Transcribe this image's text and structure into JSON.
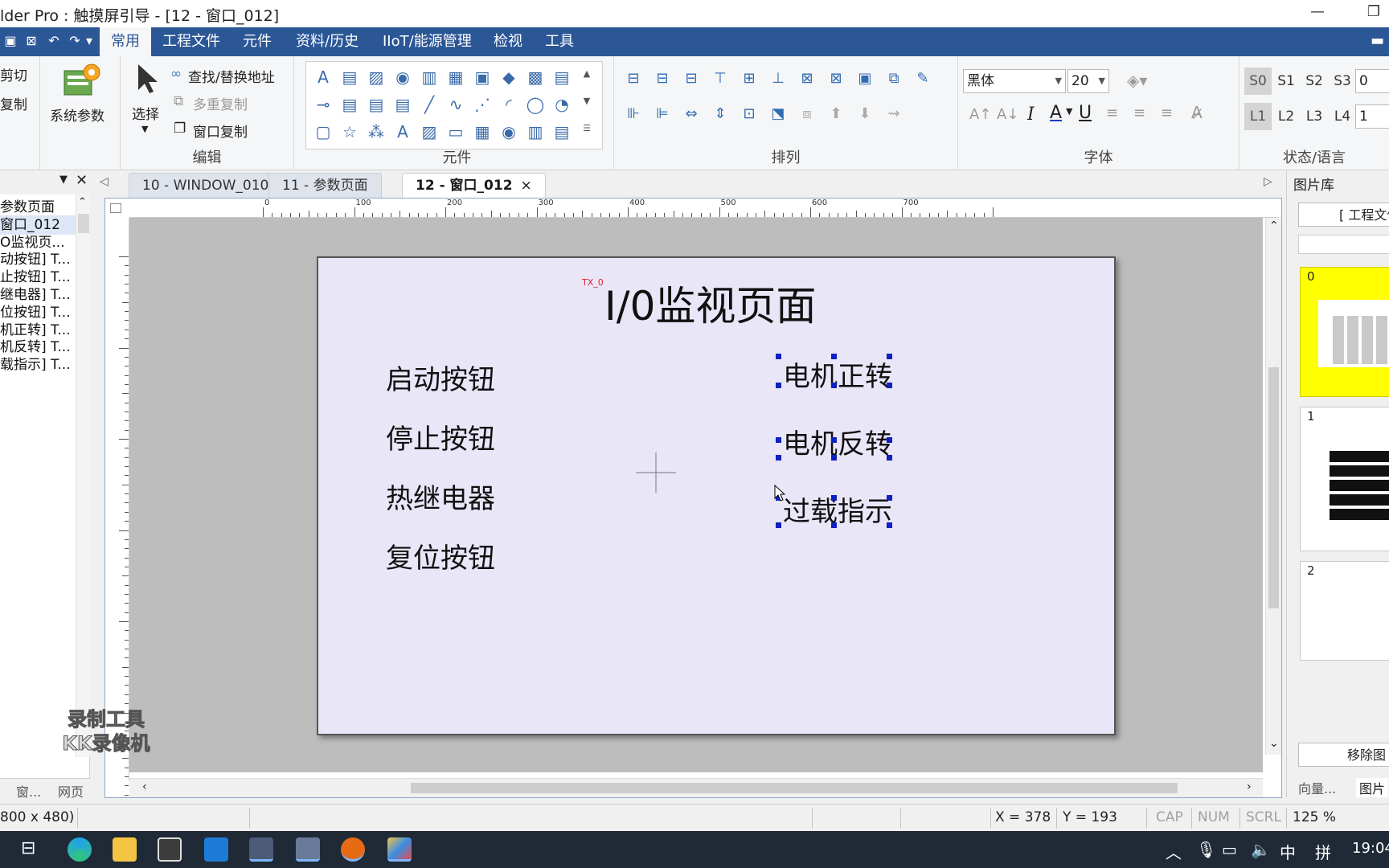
{
  "window": {
    "title": "lder Pro : 触摸屏引导 - [12 - 窗口_012]",
    "minimize_glyph": "—",
    "restore_glyph": "❐"
  },
  "menu": {
    "tabs": [
      "常用",
      "工程文件",
      "元件",
      "资料/历史",
      "IIoT/能源管理",
      "检视",
      "工具"
    ],
    "active_tab": "常用"
  },
  "ribbon": {
    "clipboard": {
      "cut": "剪切",
      "copy": "复制"
    },
    "system_params": "系统参数",
    "select": "选择",
    "edit": {
      "find_replace": "查找/替换地址",
      "multi_copy": "多重复制",
      "window_copy": "窗口复制",
      "group_label": "编辑"
    },
    "elements_label": "元件",
    "arrange_label": "排列",
    "font": {
      "name": "黑体",
      "size": "20",
      "group_label": "字体"
    },
    "state": {
      "s_buttons": [
        "S0",
        "S1",
        "S2",
        "S3"
      ],
      "s_value": "0",
      "l_buttons": [
        "L1",
        "L2",
        "L3",
        "L4"
      ],
      "l_value": "1",
      "group_label": "状态/语言"
    }
  },
  "left_panel": {
    "items": [
      "参数页面",
      "窗口_012",
      "O监视页...",
      "动按钮] T...",
      "止按钮] T...",
      "继电器] T...",
      "位按钮] T...",
      "机正转] T...",
      "机反转] T...",
      "载指示] T..."
    ],
    "selected_index": 1,
    "bottom_tabs": [
      "窗...",
      "网页"
    ]
  },
  "doc_tabs": [
    {
      "label": "10 - WINDOW_010"
    },
    {
      "label": "11 - 参数页面"
    },
    {
      "label": "12 - 窗口_012"
    }
  ],
  "doc_tab_close": "×",
  "ruler": {
    "ticks": [
      "0",
      "100",
      "200",
      "300",
      "400",
      "500",
      "600",
      "700"
    ]
  },
  "screen": {
    "title": "I/0监视页面",
    "title_tag": "TX_0",
    "left_labels": [
      "启动按钮",
      "停止按钮",
      "热继电器",
      "复位按钮"
    ],
    "right_labels": [
      "电机正转",
      "电机反转",
      "过载指示"
    ]
  },
  "right_panel": {
    "title": "图片库",
    "dropdown": "[ 工程文件",
    "thumbnails": [
      "0",
      "1",
      "2"
    ],
    "remove_btn": "移除图",
    "bottom_tabs": [
      "向量...",
      "图片"
    ]
  },
  "status": {
    "size": "800 x 480)",
    "x": "X = 378",
    "y": "Y = 193",
    "cap": "CAP",
    "num": "NUM",
    "scrl": "SCRL",
    "zoom": "125 %"
  },
  "watermark": {
    "line1": "录制工具",
    "line2": "KK录像机"
  },
  "taskbar": {
    "ime": "中",
    "ime2": "拼",
    "time": "19:04"
  }
}
